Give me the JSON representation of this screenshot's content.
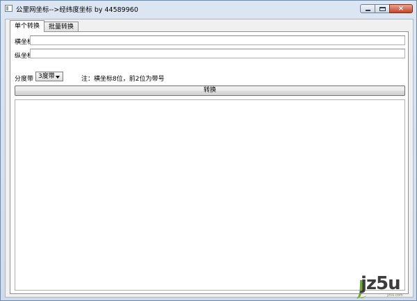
{
  "window": {
    "title": "公里网坐标-->经纬度坐标 by 44589960",
    "icon": "app-window-icon",
    "controls": {
      "minimize": "minimize-icon",
      "maximize": "maximize-icon",
      "close": "×"
    }
  },
  "tabs": [
    {
      "label": "单个转换",
      "active": true
    },
    {
      "label": "批量转换",
      "active": false
    }
  ],
  "form": {
    "x_label": "横坐标",
    "x_value": "",
    "y_label": "纵坐标",
    "y_value": "",
    "zone_label": "分度带",
    "zone_selected": "3度带",
    "note": "注：横坐标8位，前2位为带号",
    "convert_label": "转换",
    "output": ""
  },
  "watermark": {
    "text": "jz5u",
    "sub": "jz5u.com",
    "accent": "#6ea23c"
  }
}
